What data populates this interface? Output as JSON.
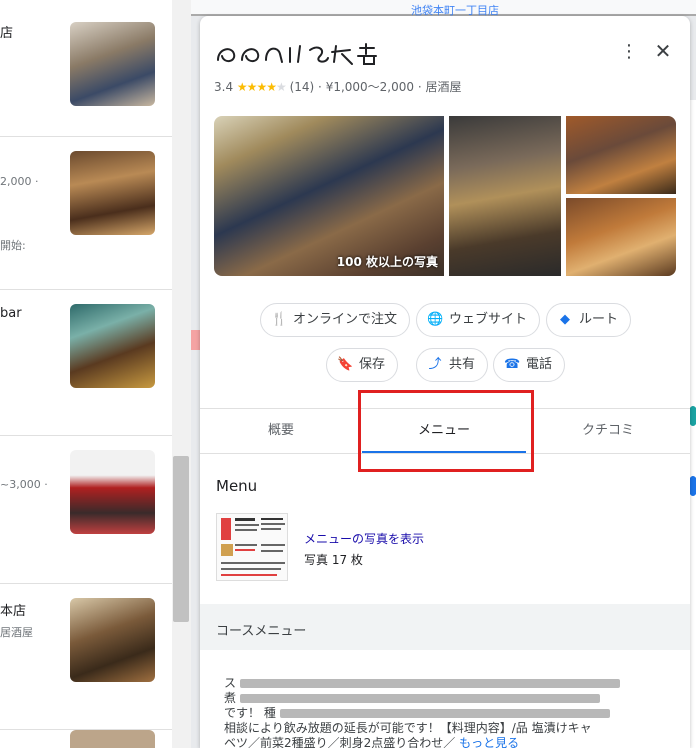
{
  "results": [
    {
      "title": "店",
      "sub": ""
    },
    {
      "title": "",
      "sub": "2,000 ·",
      "sub2": "開始:"
    },
    {
      "title": "bar",
      "sub": ""
    },
    {
      "title": "",
      "sub": "~3,000 ·"
    },
    {
      "title": "本店",
      "sub": "居酒屋"
    }
  ],
  "map": {
    "street": "池袋本町一丁目店"
  },
  "place": {
    "rating": "3.4",
    "reviews": "(14)",
    "price": "¥1,000～2,000",
    "category": "居酒屋",
    "separator": "·",
    "photo_count": "100 枚以上の写真"
  },
  "actions": {
    "order": "オンラインで注文",
    "website": "ウェブサイト",
    "route": "ルート",
    "save": "保存",
    "share": "共有",
    "call": "電話"
  },
  "tabs": {
    "overview": "概要",
    "menu": "メニュー",
    "reviews": "クチコミ"
  },
  "menu": {
    "title": "Menu",
    "link": "メニューの写真を表示",
    "photos": "写真 17 枚"
  },
  "course": {
    "title": "コースメニュー",
    "lead": "ス",
    "line1": "煮",
    "line2": "です！ 種",
    "line3": "相談により飲み放題の延長が可能です！【料理内容】/品 塩漬けキャ",
    "line4": "ベツ／前菜2種盛り／刺身2点盛り合わせ／",
    "more": "もっと見る"
  },
  "icons": {
    "more": "more-vert-icon",
    "close": "close-icon",
    "order": "cutlery-icon",
    "website": "globe-icon",
    "route": "directions-icon",
    "save": "bookmark-icon",
    "share": "share-icon",
    "call": "phone-icon"
  },
  "colors": {
    "accent": "#1a73e8",
    "star": "#fbbc04",
    "highlight": "#e02020",
    "link": "#1a0dab"
  }
}
